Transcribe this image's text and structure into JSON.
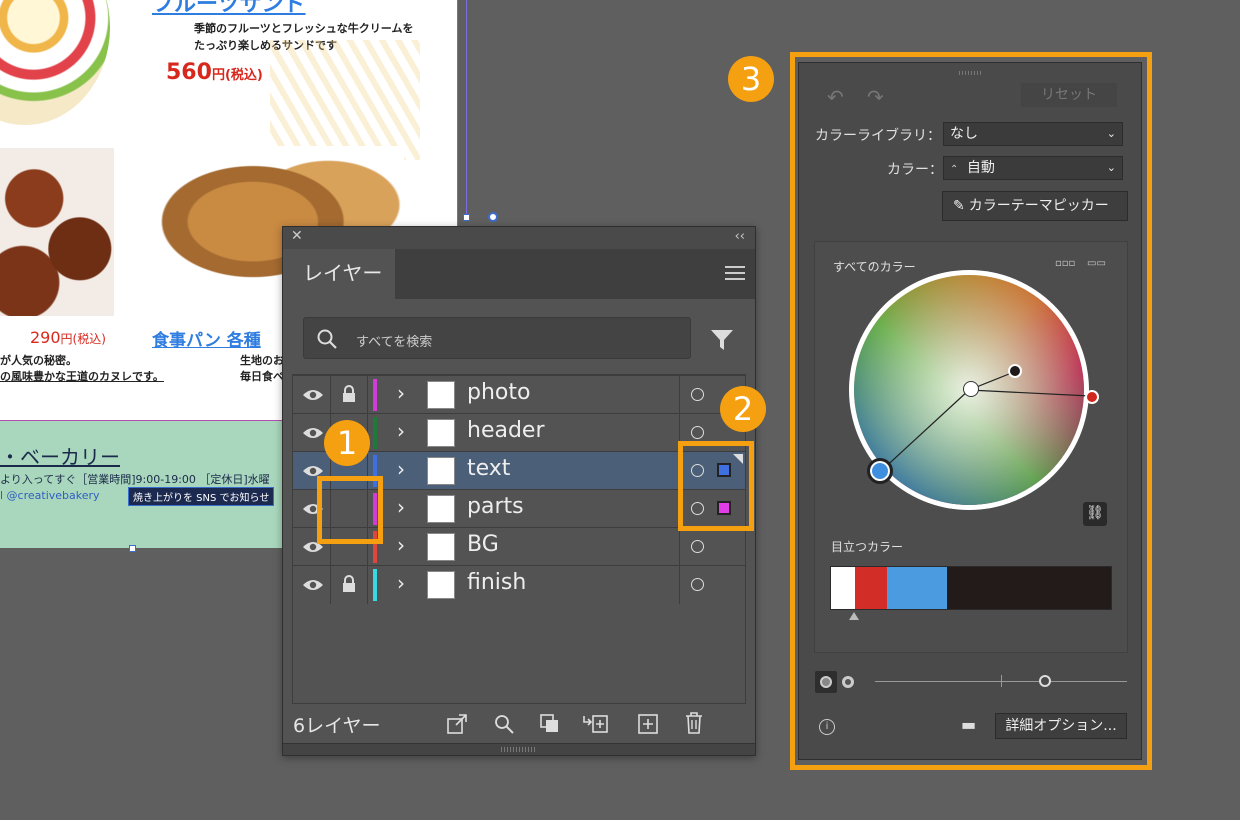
{
  "artboard": {
    "fruit_title": "フルーツサンド",
    "fruit_desc_1": "季節のフルーツとフレッシュな牛クリームを",
    "fruit_desc_2": "たっぷり楽しめるサンドです",
    "fruit_price": "560",
    "fruit_price_unit": "円(税込)",
    "canele_price": "290",
    "canele_price_unit": "円(税込)",
    "canele_desc_1": "が人気の秘密。",
    "canele_desc_2": "の風味豊かな王道のカヌレです。",
    "bread_title": "食事パン 各種",
    "bread_desc_1": "生地のお",
    "bread_desc_2": "毎日食べ",
    "shop_name": "・ベーカリー",
    "shop_info": "より入ってすぐ［営業時間]9:00-19:00 ［定休日]水曜",
    "shop_sns": "l @creativebakery",
    "shop_tag": "焼き上がりを SNS でお知らせ"
  },
  "layers_panel": {
    "close_label": "✕",
    "collapse_label": "‹‹",
    "tab_label": "レイヤー",
    "search_placeholder": "すべてを検索",
    "count_label": "6レイヤー",
    "layers": [
      {
        "name": "photo",
        "locked": true,
        "color": "#d03cd8"
      },
      {
        "name": "header",
        "locked": false,
        "color": "#1f7a3a"
      },
      {
        "name": "text",
        "locked": false,
        "color": "#3f6fe0",
        "selected": true,
        "target": "#3f6fe0"
      },
      {
        "name": "parts",
        "locked": false,
        "color": "#d03cd8",
        "target": "#e23ce8"
      },
      {
        "name": "BG",
        "locked": false,
        "color": "#e0463c"
      },
      {
        "name": "finish",
        "locked": true,
        "color": "#3ad8e0"
      }
    ]
  },
  "color_panel": {
    "reset_label": "リセット",
    "library_label": "カラーライブラリ：",
    "library_value": "なし",
    "color_label": "カラー：",
    "color_value": "自動",
    "picker_label": "カラーテーマピッカー",
    "all_colors_label": "すべてのカラー",
    "prominent_label": "目立つカラー",
    "advanced_label": "詳細オプション..."
  },
  "callouts": {
    "one": "1",
    "two": "2",
    "three": "3"
  }
}
